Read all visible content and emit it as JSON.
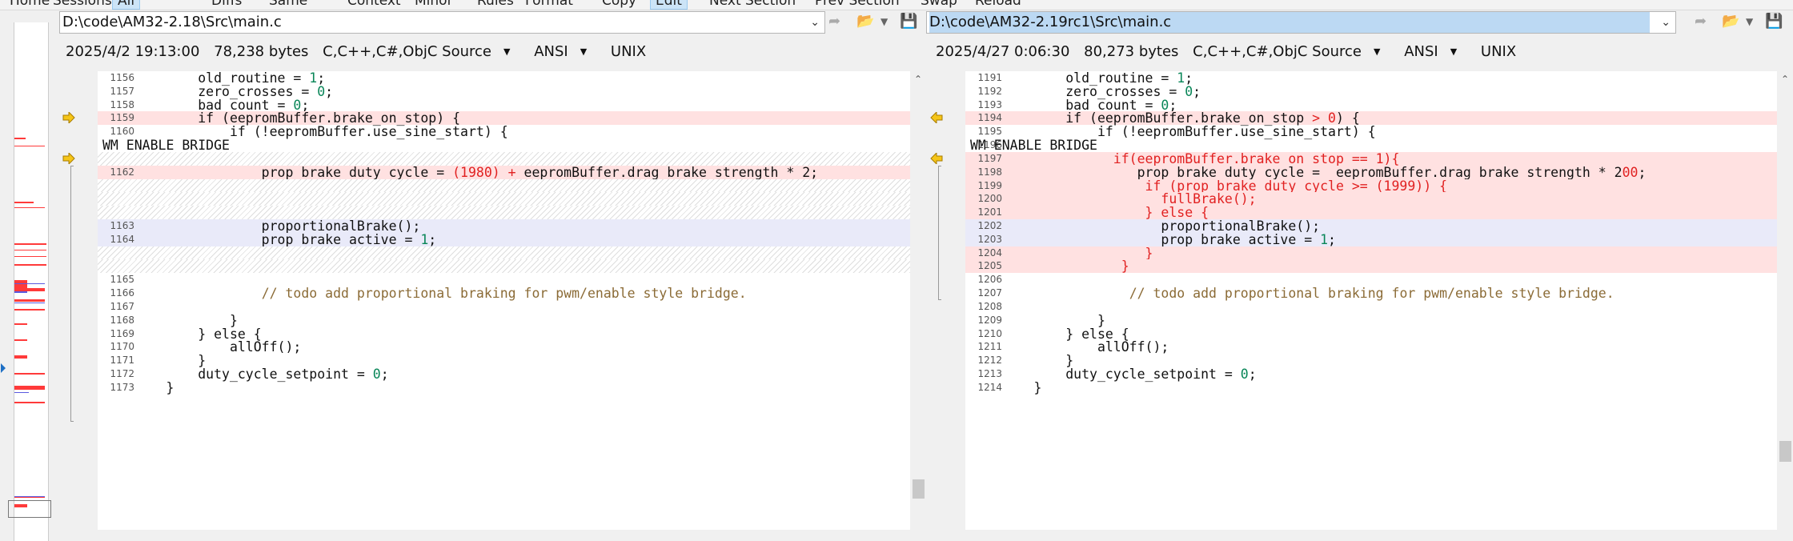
{
  "menu": {
    "items": [
      "Home",
      "Sessions",
      "All",
      "Diffs",
      "Same",
      "Context",
      "Minor",
      "Rules",
      "Format",
      "Copy",
      "Edit",
      "Next Section",
      "Prev Section",
      "Swap",
      "Reload"
    ]
  },
  "left": {
    "path": "D:\\code\\AM32-2.18\\Src\\main.c",
    "date": "2025/4/2 19:13:00",
    "size": "78,238 bytes",
    "format": "C,C++,C#,ObjC Source",
    "encoding": "ANSI",
    "line_endings": "UNIX",
    "lines": [
      {
        "n": "1156",
        "t": "            old_routine = 1;",
        "bg": "none"
      },
      {
        "n": "1157",
        "t": "            zero_crosses = 0;",
        "bg": "none"
      },
      {
        "n": "1158",
        "t": "            bad_count = 0;",
        "bg": "none"
      },
      {
        "n": "1159",
        "t": "            if (eepromBuffer.brake_on_stop) {",
        "bg": "red",
        "marker": true
      },
      {
        "n": "1160",
        "t": "                if (!eepromBuffer.use_sine_start) {",
        "bg": "none"
      },
      {
        "n": "",
        "t": "WM_ENABLE_BRIDGE",
        "bg": "none"
      },
      {
        "n": "",
        "t": "",
        "bg": "hatch",
        "marker": true
      },
      {
        "n": "1162",
        "t": "                    prop_brake_duty_cycle = (1980) + eepromBuffer.drag_brake_strength * 2;",
        "bg": "red"
      },
      {
        "n": "",
        "t": "",
        "bg": "hatch"
      },
      {
        "n": "",
        "t": "",
        "bg": "hatch"
      },
      {
        "n": "",
        "t": "",
        "bg": "hatch"
      },
      {
        "n": "1163",
        "t": "                    proportionalBrake();",
        "bg": "blue"
      },
      {
        "n": "1164",
        "t": "                    prop_brake_active = 1;",
        "bg": "blue"
      },
      {
        "n": "",
        "t": "",
        "bg": "hatch"
      },
      {
        "n": "",
        "t": "",
        "bg": "hatch"
      },
      {
        "n": "1165",
        "t": "",
        "bg": "none"
      },
      {
        "n": "1166",
        "t": "                    // todo add proportional braking for pwm/enable style bridge.",
        "bg": "none"
      },
      {
        "n": "1167",
        "t": "",
        "bg": "none"
      },
      {
        "n": "1168",
        "t": "                }",
        "bg": "none"
      },
      {
        "n": "1169",
        "t": "            } else {",
        "bg": "none"
      },
      {
        "n": "1170",
        "t": "                allOff();",
        "bg": "none"
      },
      {
        "n": "1171",
        "t": "            }",
        "bg": "none"
      },
      {
        "n": "1172",
        "t": "            duty_cycle_setpoint = 0;",
        "bg": "none"
      },
      {
        "n": "1173",
        "t": "        }",
        "bg": "none"
      }
    ]
  },
  "right": {
    "path": "D:\\code\\AM32-2.19rc1\\Src\\main.c",
    "date": "2025/4/27 0:06:30",
    "size": "80,273 bytes",
    "format": "C,C++,C#,ObjC Source",
    "encoding": "ANSI",
    "line_endings": "UNIX",
    "lines": [
      {
        "n": "1191",
        "t": "            old_routine = 1;",
        "bg": "none"
      },
      {
        "n": "1192",
        "t": "            zero_crosses = 0;",
        "bg": "none"
      },
      {
        "n": "1193",
        "t": "            bad_count = 0;",
        "bg": "none"
      },
      {
        "n": "1194",
        "t": "            if (eepromBuffer.brake_on_stop > 0) {",
        "bg": "red",
        "marker": true
      },
      {
        "n": "1195",
        "t": "                if (!eepromBuffer.use_sine_start) {",
        "bg": "none"
      },
      {
        "n": "1196",
        "t": "WM_ENABLE_BRIDGE",
        "bg": "none"
      },
      {
        "n": "1197",
        "t": "                  if(eepromBuffer.brake_on_stop == 1){",
        "bg": "red",
        "marker": true,
        "allred": true
      },
      {
        "n": "1198",
        "t": "                     prop_brake_duty_cycle =  eepromBuffer.drag_brake_strength * 200;",
        "bg": "red"
      },
      {
        "n": "1199",
        "t": "                      if (prop_brake_duty_cycle >= (1999)) {",
        "bg": "red",
        "allred": true
      },
      {
        "n": "1200",
        "t": "                        fullBrake();",
        "bg": "red",
        "allred": true
      },
      {
        "n": "1201",
        "t": "                      } else {",
        "bg": "red",
        "allred": true
      },
      {
        "n": "1202",
        "t": "                        proportionalBrake();",
        "bg": "blue"
      },
      {
        "n": "1203",
        "t": "                        prop_brake_active = 1;",
        "bg": "blue"
      },
      {
        "n": "1204",
        "t": "                      }",
        "bg": "red",
        "allred": true
      },
      {
        "n": "1205",
        "t": "                   }",
        "bg": "red",
        "allred": true
      },
      {
        "n": "1206",
        "t": "",
        "bg": "none"
      },
      {
        "n": "1207",
        "t": "                    // todo add proportional braking for pwm/enable style bridge.",
        "bg": "none"
      },
      {
        "n": "1208",
        "t": "",
        "bg": "none"
      },
      {
        "n": "1209",
        "t": "                }",
        "bg": "none"
      },
      {
        "n": "1210",
        "t": "            } else {",
        "bg": "none"
      },
      {
        "n": "1211",
        "t": "                allOff();",
        "bg": "none"
      },
      {
        "n": "1212",
        "t": "            }",
        "bg": "none"
      },
      {
        "n": "1213",
        "t": "            duty_cycle_setpoint = 0;",
        "bg": "none"
      },
      {
        "n": "1214",
        "t": "        }",
        "bg": "none"
      }
    ]
  },
  "colors": {
    "diff_red_bg": "#ffe1e1",
    "diff_blue_bg": "#e9eaf9",
    "diff_text": "#e12121",
    "number": "#098658",
    "comment": "#8b6b36",
    "selection": "#bcd9f3"
  },
  "icons": [
    "next-diff-icon",
    "open-folder-icon",
    "save-icon",
    "dropdown-icon",
    "diff-marker-arrow-icon",
    "scroll-up-icon"
  ]
}
